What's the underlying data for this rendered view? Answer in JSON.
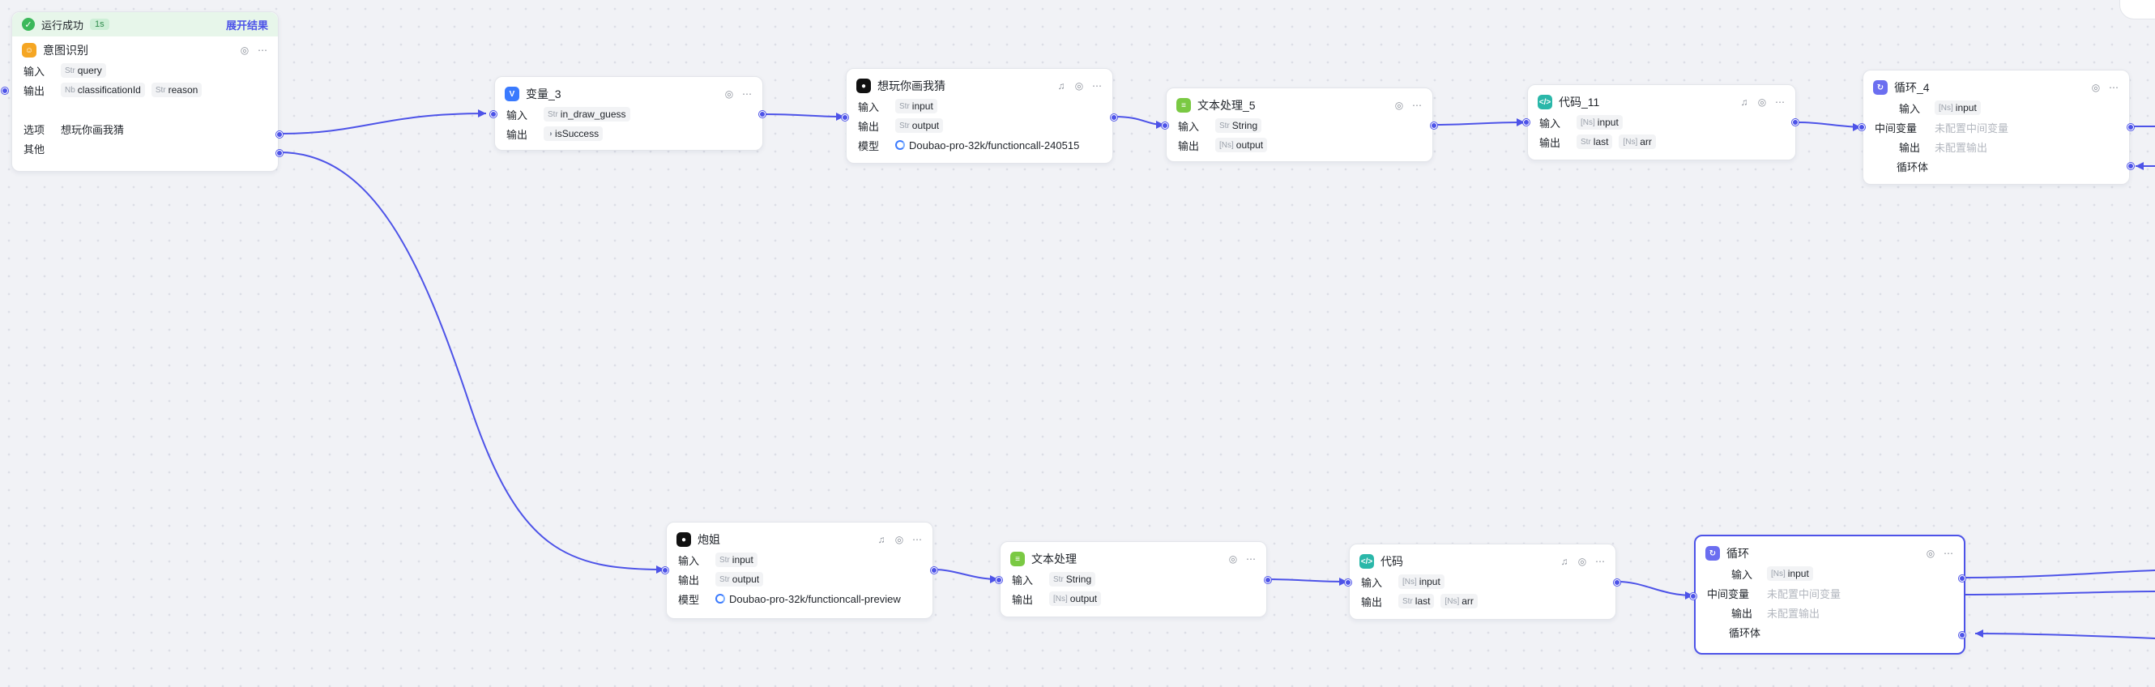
{
  "run_status": {
    "text": "运行成功",
    "duration": "1s",
    "expand": "展开结果"
  },
  "labels": {
    "input": "输入",
    "output": "输出",
    "model": "模型",
    "option": "选项",
    "other": "其他",
    "mid_var": "中间变量",
    "loop_body": "循环体",
    "unset_mid": "未配置中间变量",
    "unset_out": "未配置输出"
  },
  "types": {
    "str": "Str",
    "num": "Nb",
    "arr": "[Ns]",
    "bool": "◑"
  },
  "colors": {
    "accent": "#4d53e8",
    "success": "#3bb85a",
    "intent": "#f5a623",
    "variable": "#3a7afe",
    "text_proc": "#7ac943",
    "code": "#2ab7a9",
    "loop": "#6b6ef0"
  },
  "nodes": {
    "intent": {
      "title": "意图识别",
      "icon": "intent-icon",
      "inputs": [
        "query"
      ],
      "outputs": [
        "classificationId",
        "reason"
      ],
      "option": "想玩你画我猜"
    },
    "var3": {
      "title": "变量_3",
      "icon": "variable-icon",
      "inputs": [
        "in_draw_guess"
      ],
      "outputs": [
        "isSuccess"
      ]
    },
    "llm1": {
      "title": "想玩你画我猜",
      "icon": "llm-icon",
      "inputs": [
        "input"
      ],
      "outputs": [
        "output"
      ],
      "model": "Doubao-pro-32k/functioncall-240515"
    },
    "text5": {
      "title": "文本处理_5",
      "icon": "text-process-icon",
      "inputs": [
        "String"
      ],
      "outputs": [
        "output"
      ]
    },
    "code11": {
      "title": "代码_11",
      "icon": "code-icon",
      "inputs": [
        "input"
      ],
      "outputs": [
        "last",
        "arr"
      ]
    },
    "loop4": {
      "title": "循环_4",
      "icon": "loop-icon",
      "inputs": [
        "input"
      ]
    },
    "llm2": {
      "title": "炮姐",
      "icon": "llm-icon",
      "inputs": [
        "input"
      ],
      "outputs": [
        "output"
      ],
      "model": "Doubao-pro-32k/functioncall-preview"
    },
    "text": {
      "title": "文本处理",
      "icon": "text-process-icon",
      "inputs": [
        "String"
      ],
      "outputs": [
        "output"
      ]
    },
    "code": {
      "title": "代码",
      "icon": "code-icon",
      "inputs": [
        "input"
      ],
      "outputs": [
        "last",
        "arr"
      ]
    },
    "loop": {
      "title": "循环",
      "icon": "loop-icon",
      "inputs": [
        "input"
      ]
    }
  }
}
